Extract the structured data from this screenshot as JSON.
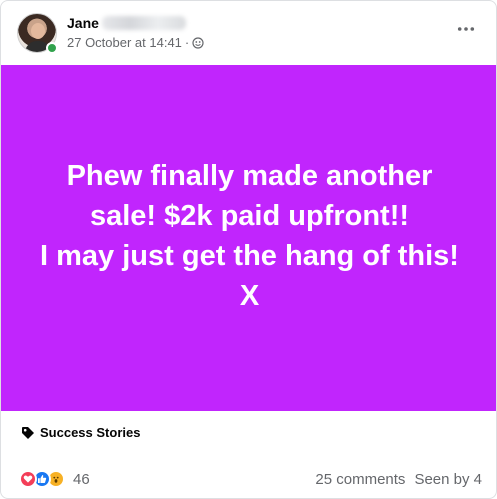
{
  "post": {
    "author_first_name": "Jane",
    "timestamp": "27 October at 14:41",
    "separator": "·",
    "audience_icon": "group-privacy-icon",
    "more_options_icon": "ellipsis-icon",
    "body_text": "Phew finally made another\nsale! $2k paid upfront!!\nI may just get the hang of this!\nX",
    "background_color": "#c125fd",
    "topic_icon": "tag-icon",
    "topic_label": "Success Stories"
  },
  "footer": {
    "reaction_icons": [
      "love-reaction-icon",
      "like-reaction-icon",
      "wow-reaction-icon"
    ],
    "reaction_count": "46",
    "comments_label": "25 comments",
    "seen_by_label": "Seen by 4"
  },
  "colors": {
    "online": "#31a24c",
    "love": "#f33e58",
    "like": "#1877f2",
    "wow": "#f7b125",
    "meta_text": "#65676b"
  }
}
